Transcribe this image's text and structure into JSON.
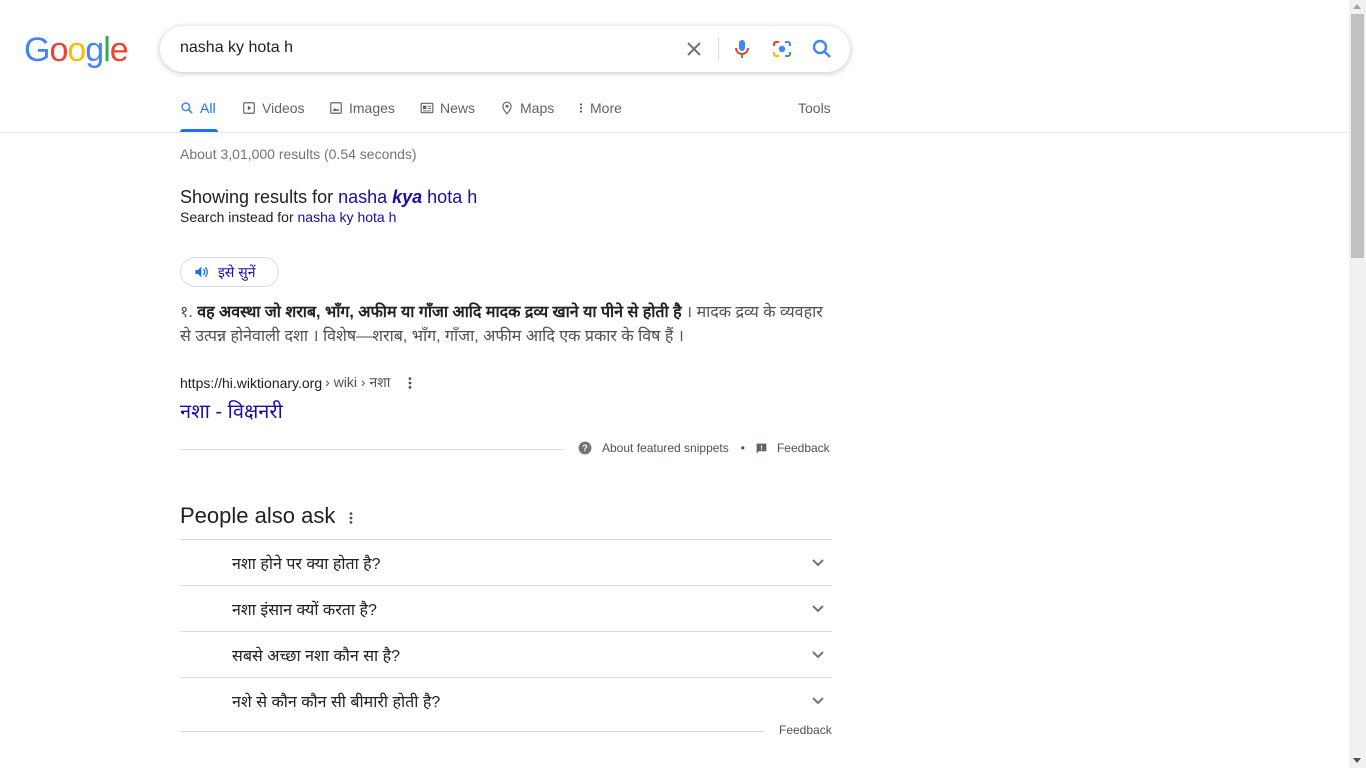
{
  "logo": {
    "letters": [
      "G",
      "o",
      "o",
      "g",
      "l",
      "e"
    ],
    "colors": [
      "#4285f4",
      "#ea4335",
      "#fbbc05",
      "#4285f4",
      "#34a853",
      "#ea4335"
    ]
  },
  "search": {
    "value": "nasha ky hota h"
  },
  "tabs": [
    {
      "label": "All",
      "icon": "search-icon"
    },
    {
      "label": "Videos",
      "icon": "play-icon"
    },
    {
      "label": "Images",
      "icon": "image-icon"
    },
    {
      "label": "News",
      "icon": "news-icon"
    },
    {
      "label": "Maps",
      "icon": "map-pin-icon"
    },
    {
      "label": "More",
      "icon": "kebab-icon"
    }
  ],
  "tools_label": "Tools",
  "result_stats": "About 3,01,000 results (0.54 seconds)",
  "spelling": {
    "prefix": "Showing results for ",
    "corrected_part1": "nasha ",
    "corrected_bold": "kya",
    "corrected_part2": " hota h",
    "instead_prefix": "Search instead for ",
    "instead_query": "nasha ky hota h"
  },
  "listen_label": "इसे सुनें",
  "snippet": {
    "number": "१. ",
    "bold_text": "वह अवस्था जो शराब, भाँग, अफीम या गाँजा आदि मादक द्रव्य खाने या पीने से होती है",
    "rest_text": " । मादक द्रव्य के व्यवहार से उत्पन्न होनेवाली दशा । विशेष—शराब, भाँग, गाँजा, अफीम आदि एक प्रकार के विष हैं ।",
    "cite_domain": "https://hi.wiktionary.org",
    "cite_path": "› wiki › नशा",
    "title": "नशा - विक्षनरी",
    "about_label": "About featured snippets",
    "bullet": "•",
    "feedback_label": "Feedback"
  },
  "people_also_ask": {
    "heading": "People also ask",
    "questions": [
      "नशा होने पर क्या होता है?",
      "नशा इंसान क्यों करता है?",
      "सबसे अच्छा नशा कौन सा है?",
      "नशे से कौन कौन सी बीमारी होती है?"
    ],
    "feedback_label": "Feedback"
  }
}
